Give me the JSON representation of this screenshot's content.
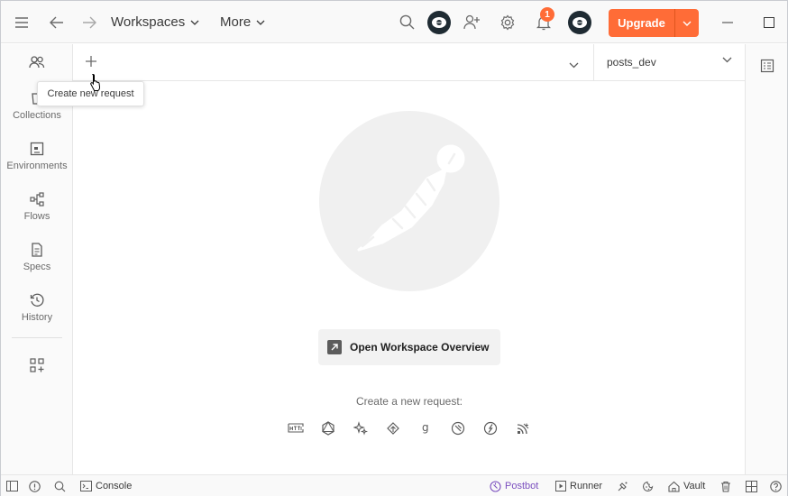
{
  "header": {
    "workspaces_label": "Workspaces",
    "more_label": "More",
    "upgrade_label": "Upgrade",
    "notification_count": "1"
  },
  "sidebar": {
    "items": [
      {
        "label": ""
      },
      {
        "label": "Collections"
      },
      {
        "label": "Environments"
      },
      {
        "label": "Flows"
      },
      {
        "label": "Specs"
      },
      {
        "label": "History"
      }
    ]
  },
  "tabbar": {
    "tooltip": "Create new request",
    "environment": "posts_dev"
  },
  "main": {
    "overview_button": "Open Workspace Overview",
    "new_request_label": "Create a new request:"
  },
  "statusbar": {
    "console": "Console",
    "postbot": "Postbot",
    "runner": "Runner",
    "vault": "Vault"
  },
  "colors": {
    "accent": "#ff6c37",
    "postbot": "#7b4fbf"
  }
}
